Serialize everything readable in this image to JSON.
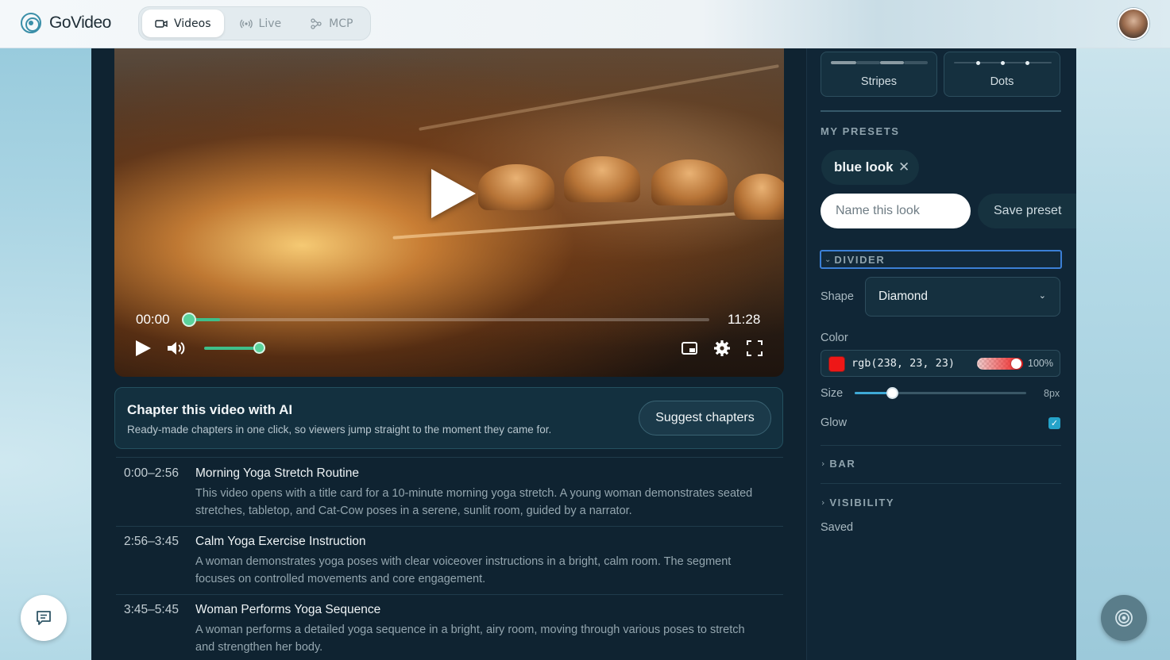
{
  "app": {
    "brand": "GoVideo",
    "tabs": [
      {
        "label": "Videos",
        "icon": "video-camera-icon",
        "active": true
      },
      {
        "label": "Live",
        "icon": "broadcast-icon",
        "active": false
      },
      {
        "label": "MCP",
        "icon": "connector-icon",
        "active": false
      }
    ]
  },
  "player": {
    "current_time": "00:00",
    "duration": "11:28",
    "progress_fraction": 0.06,
    "volume_fraction": 1.0
  },
  "chapter_card": {
    "title": "Chapter this video with AI",
    "subtitle": "Ready-made chapters in one click, so viewers jump straight to the moment they came for.",
    "button_label": "Suggest chapters"
  },
  "chapters": [
    {
      "time": "0:00–2:56",
      "title": "Morning Yoga Stretch Routine",
      "desc_line1": "This video opens with a title card for a 10-minute morning yoga stretch. A young woman demonstrates seated",
      "desc_line2": "stretches, tabletop, and Cat-Cow poses in a serene, sunlit room, guided by a narrator."
    },
    {
      "time": "2:56–3:45",
      "title": "Calm Yoga Exercise Instruction",
      "desc_line1": "A woman demonstrates yoga poses with clear voiceover instructions in a bright, calm room. The segment",
      "desc_line2": "focuses on controlled movements and core engagement."
    },
    {
      "time": "3:45–5:45",
      "title": "Woman Performs Yoga Sequence",
      "desc_line1": "A woman performs a detailed yoga sequence in a bright, airy room, moving through various poses to stretch",
      "desc_line2": "and strengthen her body."
    }
  ],
  "side": {
    "patterns": [
      {
        "label": "Stripes"
      },
      {
        "label": "Dots"
      }
    ],
    "my_presets_label": "MY PRESETS",
    "preset_chip": "blue look",
    "name_placeholder": "Name this look",
    "save_preset_label": "Save preset",
    "divider_label": "DIVIDER",
    "shape_label": "Shape",
    "shape_value": "Diamond",
    "color_label": "Color",
    "color_value": "rgb(238, 23, 23)",
    "color_hex": "#ee1717",
    "alpha_label": "100%",
    "size_label": "Size",
    "size_value": "8px",
    "size_fraction": 0.22,
    "glow_label": "Glow",
    "glow_checked": true,
    "bar_label": "BAR",
    "visibility_label": "VISIBILITY",
    "saved_label": "Saved"
  },
  "colors": {
    "accent_green": "#3fbf8a",
    "accent_blue": "#3fa9d6",
    "focus_ring": "#3b7fd6"
  }
}
